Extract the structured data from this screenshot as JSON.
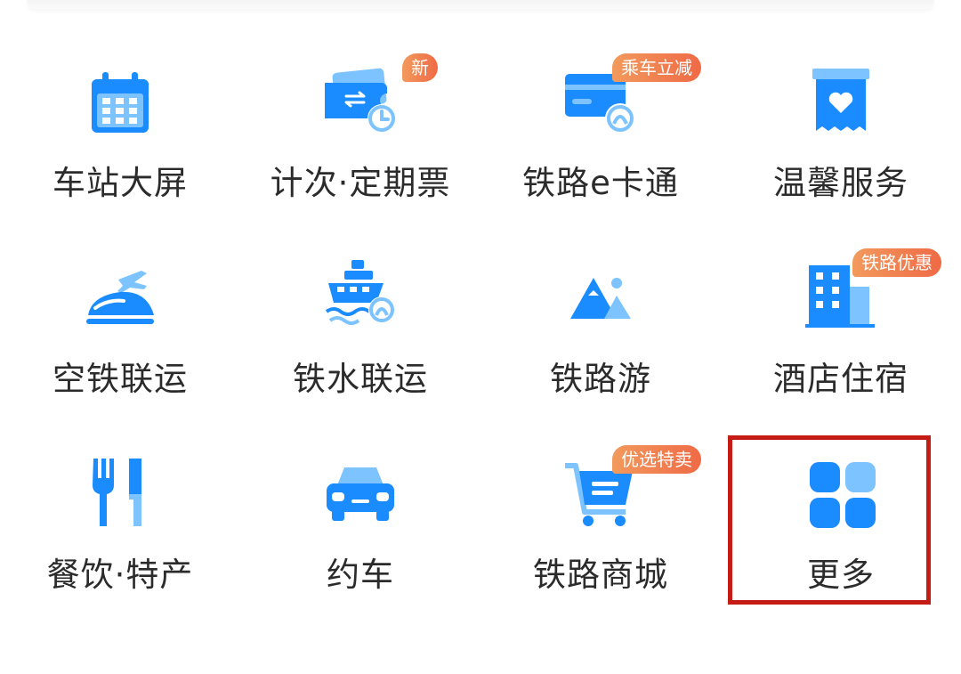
{
  "colors": {
    "primary": "#1a8cff",
    "light": "#7cc3ff",
    "badge": "#ef6a46",
    "highlight": "#c51d16",
    "text": "#2b2b2b"
  },
  "grid": {
    "items": [
      {
        "label": "车站大屏",
        "icon": "calendar-icon"
      },
      {
        "label": "计次·定期票",
        "icon": "ticket-clock-icon",
        "badge": "新"
      },
      {
        "label": "铁路e卡通",
        "icon": "rail-card-icon",
        "badge": "乘车立减"
      },
      {
        "label": "温馨服务",
        "icon": "heart-service-icon"
      },
      {
        "label": "空铁联运",
        "icon": "plane-train-icon"
      },
      {
        "label": "铁水联运",
        "icon": "ship-rail-icon"
      },
      {
        "label": "铁路游",
        "icon": "mountain-icon"
      },
      {
        "label": "酒店住宿",
        "icon": "hotel-building-icon",
        "badge": "铁路优惠"
      },
      {
        "label": "餐饮·特产",
        "icon": "fork-knife-icon"
      },
      {
        "label": "约车",
        "icon": "car-icon"
      },
      {
        "label": "铁路商城",
        "icon": "shopping-cart-icon",
        "badge": "优选特卖"
      },
      {
        "label": "更多",
        "icon": "more-grid-icon"
      }
    ]
  }
}
